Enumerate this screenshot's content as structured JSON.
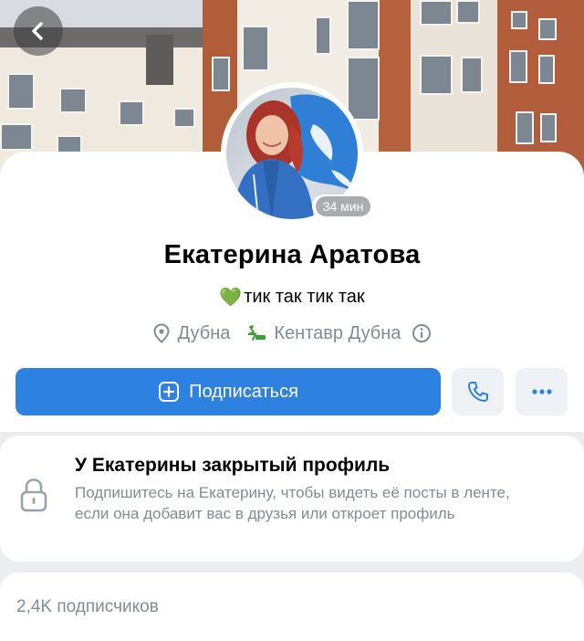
{
  "header": {
    "back_icon": "chevron-left-icon"
  },
  "profile": {
    "name": "Екатерина Аратова",
    "status_emoji": "💚",
    "status_text": "тик так тик так",
    "online_badge": "34 мин",
    "city": "Дубна",
    "community": "Кентавр Дубна",
    "icons": {
      "city": "location-pin-icon",
      "community": "community-logo-icon",
      "info": "info-icon"
    }
  },
  "actions": {
    "subscribe_label": "Подписаться",
    "subscribe_icon": "plus-square-icon",
    "call_icon": "phone-icon",
    "more_icon": "more-dots-icon"
  },
  "closed_profile": {
    "title": "У Екатерины закрытый профиль",
    "text": "Подпишитесь на Екатерину, чтобы видеть её посты в ленте, если она добавит вас в друзья или откроет профиль",
    "icon": "lock-icon"
  },
  "followers": {
    "label": "2,4K подписчиков"
  },
  "colors": {
    "accent": "#2d81e0",
    "secondary_text": "#818c99",
    "background": "#ebedf0",
    "status_emoji": "#3ec13e"
  }
}
